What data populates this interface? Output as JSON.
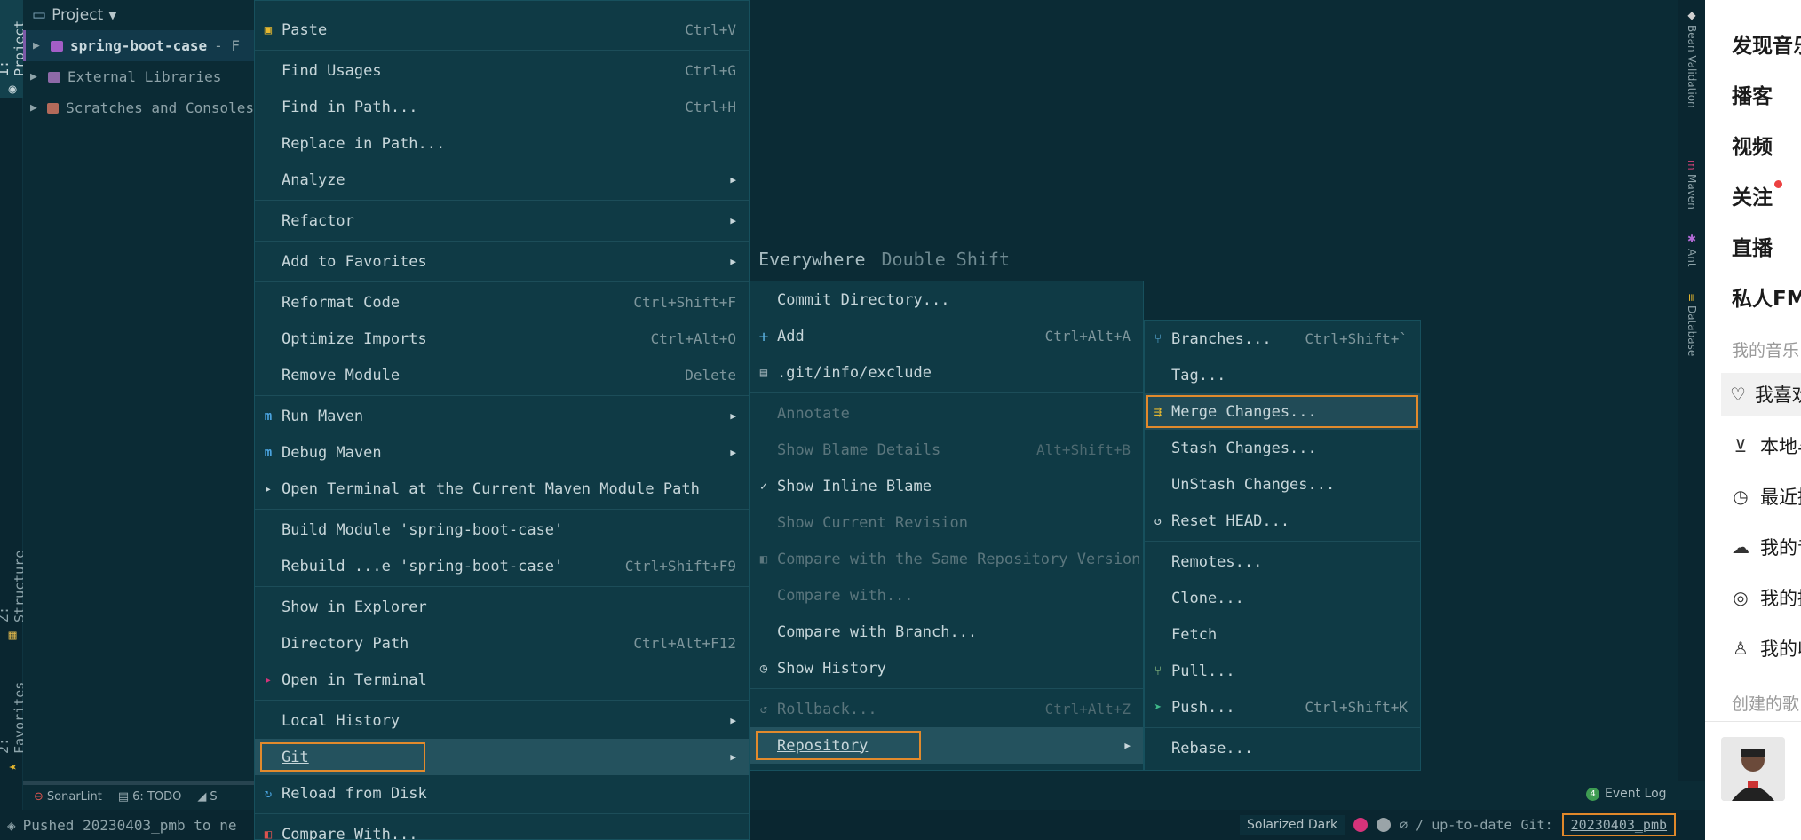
{
  "left_tabs": {
    "project": "1: Project",
    "structure": "Z: Structure",
    "favorites": "2: Favorites"
  },
  "project": {
    "header": "Project",
    "rows": [
      {
        "label": "spring-boot-case",
        "suffix": "- F"
      },
      {
        "label": "External Libraries"
      },
      {
        "label": "Scratches and Consoles"
      }
    ]
  },
  "search_hint": {
    "text": "n Everywhere",
    "shortcut": "Double Shift"
  },
  "right_tabs": [
    "Bean Validation",
    "Maven",
    "Ant",
    "Database"
  ],
  "tool_bar": {
    "sonarlint": "SonarLint",
    "todo": "6: TODO",
    "s": "S"
  },
  "status": {
    "message": "Pushed 20230403_pmb to ne",
    "theme": "Solarized Dark",
    "up_to_date": "∅ / up-to-date",
    "git_label": "Git:",
    "branch": "20230403_pmb",
    "event_log": "Event Log",
    "event_count": "4"
  },
  "main_menu": {
    "paste": {
      "label": "Paste",
      "shortcut": "Ctrl+V"
    },
    "find_usages": {
      "label": "Find Usages",
      "shortcut": "Ctrl+G"
    },
    "find_in_path": {
      "label": "Find in Path...",
      "shortcut": "Ctrl+H"
    },
    "replace_in_path": {
      "label": "Replace in Path..."
    },
    "analyze": {
      "label": "Analyze"
    },
    "refactor": {
      "label": "Refactor"
    },
    "add_to_favorites": {
      "label": "Add to Favorites"
    },
    "reformat_code": {
      "label": "Reformat Code",
      "shortcut": "Ctrl+Shift+F"
    },
    "optimize_imports": {
      "label": "Optimize Imports",
      "shortcut": "Ctrl+Alt+O"
    },
    "remove_module": {
      "label": "Remove Module",
      "shortcut": "Delete"
    },
    "run_maven": {
      "label": "Run Maven"
    },
    "debug_maven": {
      "label": "Debug Maven"
    },
    "open_terminal_maven": {
      "label": "Open Terminal at the Current Maven Module Path"
    },
    "build_module": {
      "label": "Build Module 'spring-boot-case'"
    },
    "rebuild": {
      "label": "Rebuild ...e 'spring-boot-case'",
      "shortcut": "Ctrl+Shift+F9"
    },
    "show_in_explorer": {
      "label": "Show in Explorer"
    },
    "directory_path": {
      "label": "Directory Path",
      "shortcut": "Ctrl+Alt+F12"
    },
    "open_in_terminal": {
      "label": "Open in Terminal"
    },
    "local_history": {
      "label": "Local History"
    },
    "git": {
      "label": "Git"
    },
    "reload_from_disk": {
      "label": "Reload from Disk"
    },
    "compare_with": {
      "label": "Compare With..."
    }
  },
  "git_menu": {
    "commit_directory": {
      "label": "Commit Directory..."
    },
    "add": {
      "label": "Add",
      "shortcut": "Ctrl+Alt+A"
    },
    "exclude": {
      "label": ".git/info/exclude"
    },
    "annotate": {
      "label": "Annotate"
    },
    "show_blame_details": {
      "label": "Show Blame Details",
      "shortcut": "Alt+Shift+B"
    },
    "show_inline_blame": {
      "label": "Show Inline Blame"
    },
    "show_current_revision": {
      "label": "Show Current Revision"
    },
    "compare_same_repo": {
      "label": "Compare with the Same Repository Version"
    },
    "compare_with": {
      "label": "Compare with..."
    },
    "compare_with_branch": {
      "label": "Compare with Branch..."
    },
    "show_history": {
      "label": "Show History"
    },
    "rollback": {
      "label": "Rollback...",
      "shortcut": "Ctrl+Alt+Z"
    },
    "repository": {
      "label": "Repository"
    }
  },
  "repo_menu": {
    "branches": {
      "label": "Branches...",
      "shortcut": "Ctrl+Shift+`"
    },
    "tag": {
      "label": "Tag..."
    },
    "merge_changes": {
      "label": "Merge Changes..."
    },
    "stash_changes": {
      "label": "Stash Changes..."
    },
    "unstash_changes": {
      "label": "UnStash Changes..."
    },
    "reset_head": {
      "label": "Reset HEAD..."
    },
    "remotes": {
      "label": "Remotes..."
    },
    "clone": {
      "label": "Clone..."
    },
    "fetch": {
      "label": "Fetch"
    },
    "pull": {
      "label": "Pull..."
    },
    "push": {
      "label": "Push...",
      "shortcut": "Ctrl+Shift+K"
    },
    "rebase": {
      "label": "Rebase..."
    }
  },
  "music": {
    "discover": "发现音乐",
    "podcast": "播客",
    "video": "视频",
    "follow": "关注",
    "live": "直播",
    "fm": "私人FM",
    "my_music": "我的音乐",
    "liked": "我喜欢",
    "local": "本地与",
    "recent": "最近播",
    "cloud": "我的音",
    "podcast_mine": "我的播",
    "collect": "我的收",
    "created": "创建的歌"
  },
  "colors": {
    "accent_orange": "#e28a2c",
    "menu_bg": "#0f3a45",
    "editor_bg": "#0b2b35"
  }
}
